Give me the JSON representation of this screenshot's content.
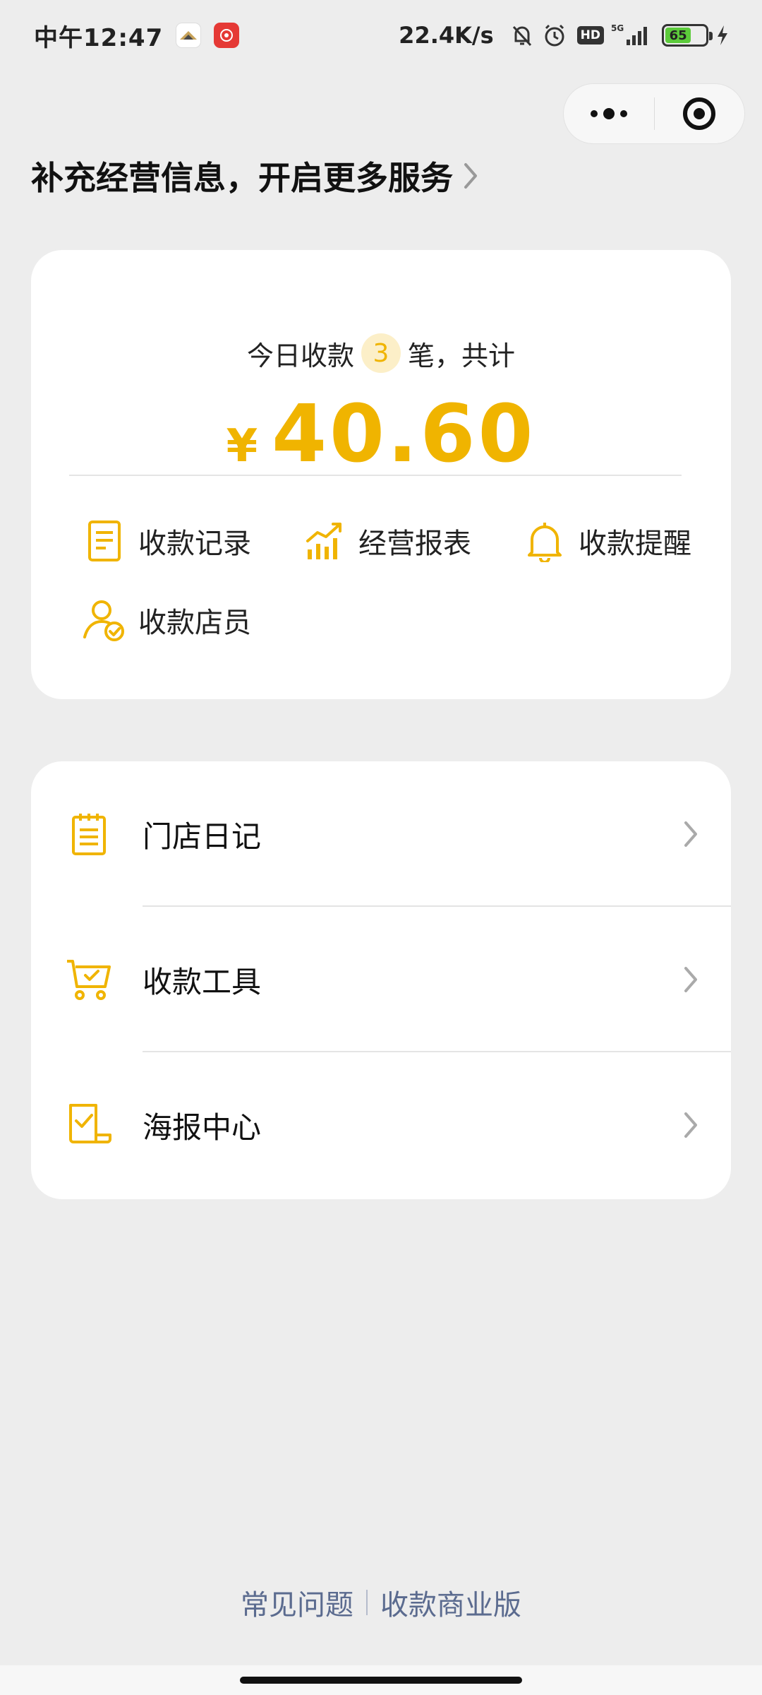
{
  "status_bar": {
    "time": "中午12:47",
    "network_speed": "22.4K/s",
    "hd_label": "HD",
    "signal_label": "5G",
    "battery_level": "65"
  },
  "capsule": {
    "more_icon": "more-dots-icon",
    "close_icon": "target-circle-icon"
  },
  "header": {
    "title": "补充经营信息，开启更多服务"
  },
  "summary": {
    "today_prefix": "今日收款",
    "today_count": "3",
    "today_suffix": "笔，共计",
    "currency": "¥",
    "amount": "40.60"
  },
  "quick_actions": [
    {
      "label": "收款记录",
      "icon": "document-icon"
    },
    {
      "label": "经营报表",
      "icon": "chart-icon"
    },
    {
      "label": "收款提醒",
      "icon": "bell-icon"
    },
    {
      "label": "收款店员",
      "icon": "staff-check-icon"
    }
  ],
  "menu": [
    {
      "label": "门店日记",
      "icon": "notepad-icon"
    },
    {
      "label": "收款工具",
      "icon": "cart-check-icon"
    },
    {
      "label": "海报中心",
      "icon": "poster-check-icon"
    }
  ],
  "footer": {
    "faq": "常见问题",
    "business": "收款商业版"
  },
  "colors": {
    "accent": "#f0b400",
    "background": "#ededed",
    "link": "#5b6b8f"
  }
}
